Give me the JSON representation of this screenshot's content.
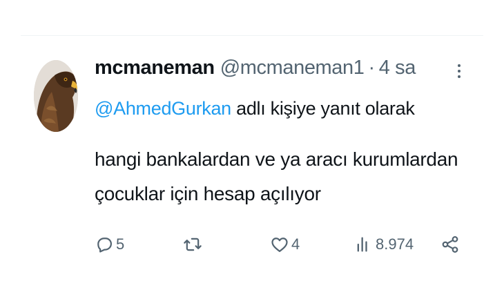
{
  "tweet": {
    "display_name": "mcmaneman",
    "handle": "@mcmaneman1",
    "separator": "·",
    "time": "4 sa",
    "reply_to": {
      "mention": "@AhmedGurkan",
      "suffix": " adlı kişiye yanıt olarak"
    },
    "text_lines": [
      "hangi bankalardan ve ya aracı kurumlardan",
      "çocuklar için hesap açılıyor"
    ],
    "avatar": "eagle-profile-image"
  },
  "actions": {
    "reply": {
      "icon": "reply-bubble-icon",
      "count": "5"
    },
    "retweet": {
      "icon": "retweet-icon",
      "count": ""
    },
    "like": {
      "icon": "heart-icon",
      "count": "4"
    },
    "views": {
      "icon": "bar-chart-icon",
      "count": "8.974"
    },
    "share": {
      "icon": "share-nodes-icon"
    }
  },
  "colors": {
    "text": "#0f1419",
    "secondary": "#536471",
    "link": "#1d9bf0",
    "divider": "#eff3f4"
  }
}
